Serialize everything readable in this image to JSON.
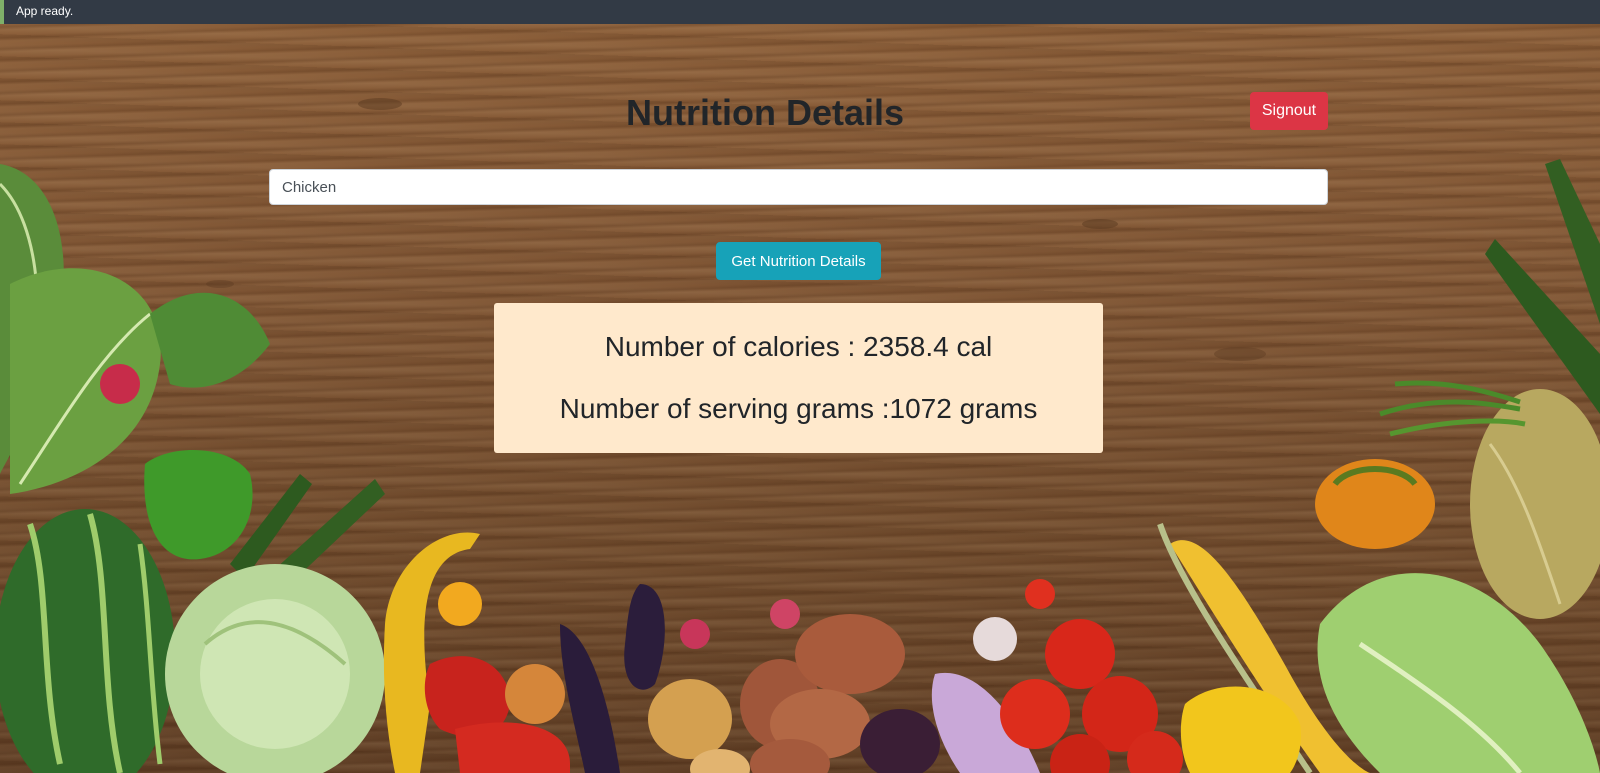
{
  "status": {
    "message": "App ready."
  },
  "header": {
    "title": "Nutrition Details",
    "signout_label": "Signout"
  },
  "search": {
    "value": "Chicken"
  },
  "actions": {
    "get_details_label": "Get Nutrition Details"
  },
  "results": {
    "calories_text": "Number of calories : 2358.4 cal",
    "grams_text": "Number of serving grams :1072 grams"
  },
  "colors": {
    "signout": "#dc3545",
    "primary_action": "#17a2b8",
    "result_card": "#ffe9cc",
    "status_bar": "#323a45"
  }
}
